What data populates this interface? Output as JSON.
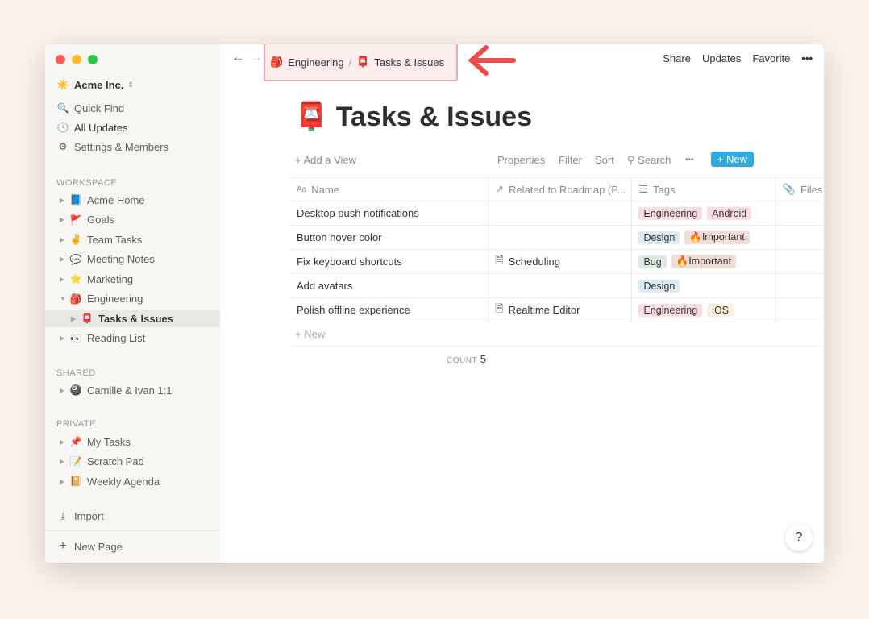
{
  "sidebar": {
    "workspace": "Acme Inc.",
    "quick_find": "Quick Find",
    "all_updates": "All Updates",
    "settings": "Settings & Members",
    "workspace_label": "WORKSPACE",
    "shared_label": "SHARED",
    "private_label": "PRIVATE",
    "workspace_items": [
      {
        "icon": "📘",
        "label": "Acme Home"
      },
      {
        "icon": "🚩",
        "label": "Goals"
      },
      {
        "icon": "✌️",
        "label": "Team Tasks"
      },
      {
        "icon": "💬",
        "label": "Meeting Notes"
      },
      {
        "icon": "⭐",
        "label": "Marketing"
      },
      {
        "icon": "🎒",
        "label": "Engineering"
      },
      {
        "icon": "📮",
        "label": "Tasks & Issues"
      },
      {
        "icon": "👀",
        "label": "Reading List"
      }
    ],
    "shared_items": [
      {
        "icon": "🎱",
        "label": "Camille & Ivan 1:1"
      }
    ],
    "private_items": [
      {
        "icon": "📌",
        "label": "My Tasks"
      },
      {
        "icon": "📝",
        "label": "Scratch Pad"
      },
      {
        "icon": "📔",
        "label": "Weekly Agenda"
      }
    ],
    "import": "Import",
    "new_page": "New Page"
  },
  "topbar": {
    "breadcrumb": [
      {
        "icon": "🎒",
        "label": "Engineering"
      },
      {
        "icon": "📮",
        "label": "Tasks & Issues"
      }
    ],
    "separator": "/",
    "share": "Share",
    "updates": "Updates",
    "favorite": "Favorite",
    "more": "•••"
  },
  "page": {
    "icon": "📮",
    "title": "Tasks & Issues"
  },
  "toolbar": {
    "add_view": "Add a View",
    "properties": "Properties",
    "filter": "Filter",
    "sort": "Sort",
    "search": "Search",
    "more": "•••",
    "new": "New"
  },
  "table": {
    "columns": [
      "Name",
      "Related to Roadmap (P...",
      "Tags",
      "Files"
    ],
    "rows": [
      {
        "name": "Desktop push notifications",
        "related": "",
        "tags": [
          "Engineering",
          "Android"
        ]
      },
      {
        "name": "Button hover color",
        "related": "",
        "tags": [
          "Design",
          "🔥Important"
        ]
      },
      {
        "name": "Fix keyboard shortcuts",
        "related": "Scheduling",
        "tags": [
          "Bug",
          "🔥Important"
        ]
      },
      {
        "name": "Add avatars",
        "related": "",
        "tags": [
          "Design"
        ]
      },
      {
        "name": "Polish offline experience",
        "related": "Realtime Editor",
        "tags": [
          "Engineering",
          "iOS"
        ]
      }
    ],
    "new_row": "New",
    "count_label": "COUNT",
    "count": "5"
  },
  "tag_colors": {
    "Engineering": "#f9dde3",
    "Android": "#f9dde3",
    "Design": "#dbeaf6",
    "🔥Important": "#f2dcd8",
    "Bug": "#dbeae3",
    "iOS": "#fbeedb"
  },
  "help": "?"
}
